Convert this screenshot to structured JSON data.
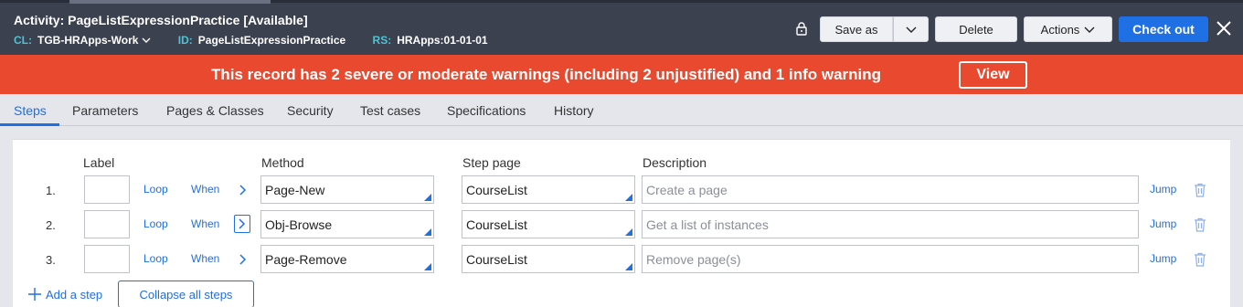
{
  "header": {
    "title_prefix": "Activity: PageListExpressionPractice",
    "status": "[Available]",
    "cl_key": "CL:",
    "cl_value": "TGB-HRApps-Work",
    "id_key": "ID:",
    "id_value": "PageListExpressionPractice",
    "rs_key": "RS:",
    "rs_value": "HRApps:01-01-01",
    "save_as_label": "Save as",
    "delete_label": "Delete",
    "actions_label": "Actions",
    "checkout_label": "Check out"
  },
  "warning": {
    "message": "This record has 2 severe or moderate warnings (including 2 unjustified) and 1 info warning",
    "view_label": "View"
  },
  "tabs": [
    {
      "label": "Steps",
      "active": true
    },
    {
      "label": "Parameters"
    },
    {
      "label": "Pages & Classes"
    },
    {
      "label": "Security"
    },
    {
      "label": "Test cases"
    },
    {
      "label": "Specifications"
    },
    {
      "label": "History"
    }
  ],
  "columns": {
    "label": "Label",
    "method": "Method",
    "step_page": "Step page",
    "description": "Description"
  },
  "steps": [
    {
      "num": "1.",
      "loop": "Loop",
      "when": "When",
      "method": "Page-New",
      "step_page": "CourseList",
      "description": "Create a page",
      "jump": "Jump"
    },
    {
      "num": "2.",
      "loop": "Loop",
      "when": "When",
      "method": "Obj-Browse",
      "step_page": "CourseList",
      "description": "Get a list of instances",
      "jump": "Jump"
    },
    {
      "num": "3.",
      "loop": "Loop",
      "when": "When",
      "method": "Page-Remove",
      "step_page": "CourseList",
      "description": "Remove page(s)",
      "jump": "Jump"
    }
  ],
  "footer": {
    "add_step_label": "Add a step",
    "collapse_label": "Collapse all steps"
  },
  "colors": {
    "accent": "#1f6fe5",
    "header_bg": "#3c4150",
    "warning_bg": "#e8492f",
    "key_teal": "#4fc3d5"
  }
}
